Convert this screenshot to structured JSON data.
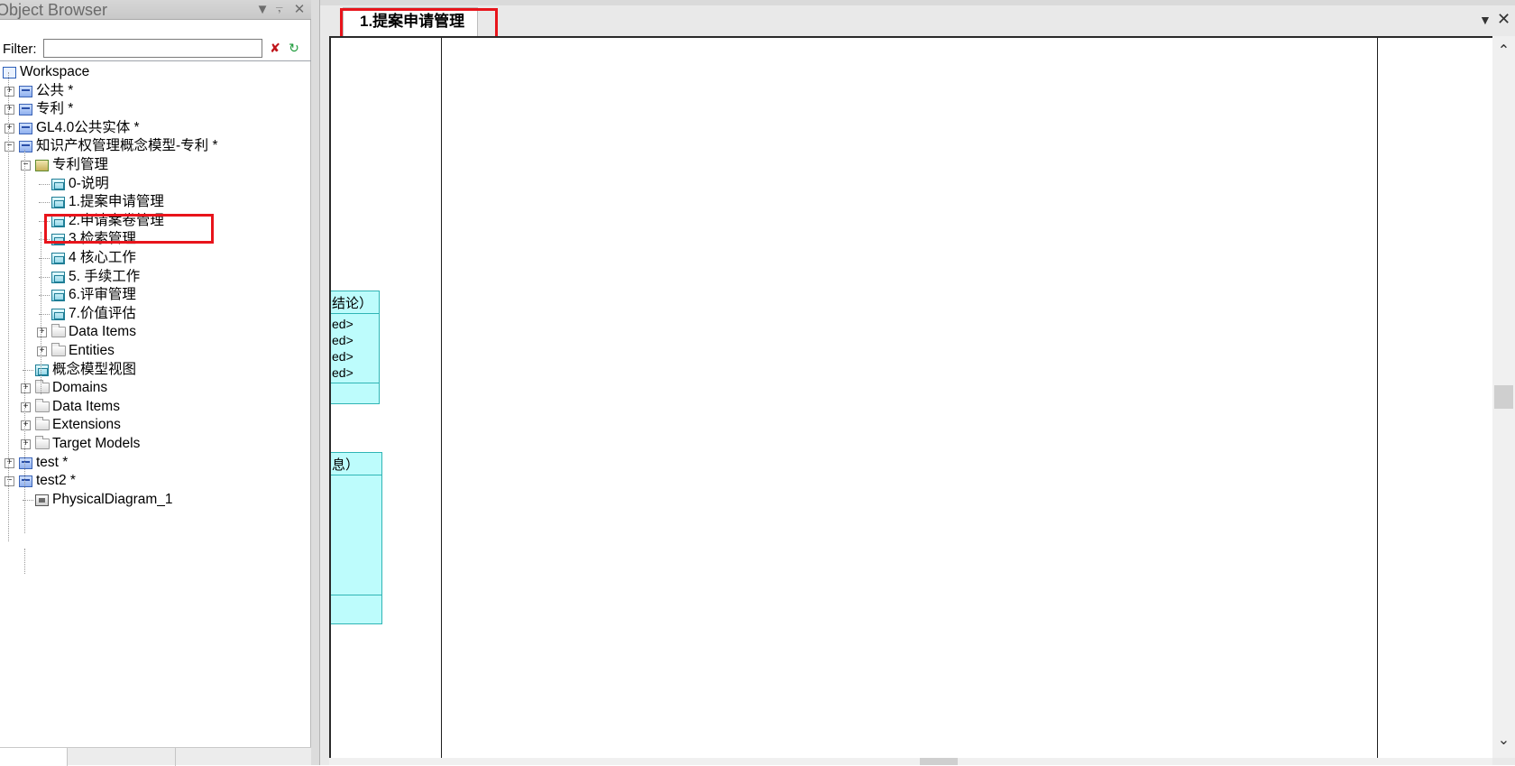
{
  "object_browser": {
    "title": "Object Browser",
    "filter_label": "Filter:",
    "filter_value": "",
    "tree": [
      {
        "label": "Workspace",
        "icon": "workspace-icon"
      },
      {
        "label": "公共 *",
        "icon": "model-icon",
        "expander": "+"
      },
      {
        "label": "专利 *",
        "icon": "model-icon",
        "expander": "+"
      },
      {
        "label": "GL4.0公共实体 *",
        "icon": "model-icon",
        "expander": "+"
      },
      {
        "label": "知识产权管理概念模型-专利 *",
        "icon": "model-icon",
        "expander": "-"
      },
      {
        "label": "专利管理",
        "icon": "package-icon",
        "expander": "-"
      },
      {
        "label": "0-说明",
        "icon": "diagram-icon"
      },
      {
        "label": "1.提案申请管理",
        "icon": "diagram-icon"
      },
      {
        "label": "2.申请案卷管理",
        "icon": "diagram-icon"
      },
      {
        "label": "3.检索管理",
        "icon": "diagram-icon"
      },
      {
        "label": "4 核心工作",
        "icon": "diagram-icon"
      },
      {
        "label": "5. 手续工作",
        "icon": "diagram-icon"
      },
      {
        "label": "6.评审管理",
        "icon": "diagram-icon"
      },
      {
        "label": "7.价值评估",
        "icon": "diagram-icon"
      },
      {
        "label": "Data Items",
        "icon": "folder-icon",
        "expander": "+"
      },
      {
        "label": "Entities",
        "icon": "folder-icon",
        "expander": "+"
      },
      {
        "label": "概念模型视图",
        "icon": "diagram-icon"
      },
      {
        "label": "Domains",
        "icon": "folder-icon",
        "expander": "+"
      },
      {
        "label": "Data Items",
        "icon": "folder-icon",
        "expander": "+"
      },
      {
        "label": "Extensions",
        "icon": "folder-icon",
        "expander": "+"
      },
      {
        "label": "Target Models",
        "icon": "folder-icon",
        "expander": "+"
      },
      {
        "label": "test *",
        "icon": "model-icon",
        "expander": "+"
      },
      {
        "label": "test2 *",
        "icon": "model-icon",
        "expander": "-"
      },
      {
        "label": "PhysicalDiagram_1",
        "icon": "physical-diagram-icon"
      }
    ]
  },
  "diagram": {
    "active_tab": "1.提案申请管理",
    "entity_1": {
      "header": "结论）",
      "rows": [
        "ed>",
        "ed>",
        "ed>",
        "ed>"
      ]
    },
    "entity_2": {
      "header": "息）"
    }
  },
  "colors": {
    "highlight": "#e8141b",
    "entity_fill": "#bdfcfc",
    "entity_border": "#2fb5b5"
  }
}
